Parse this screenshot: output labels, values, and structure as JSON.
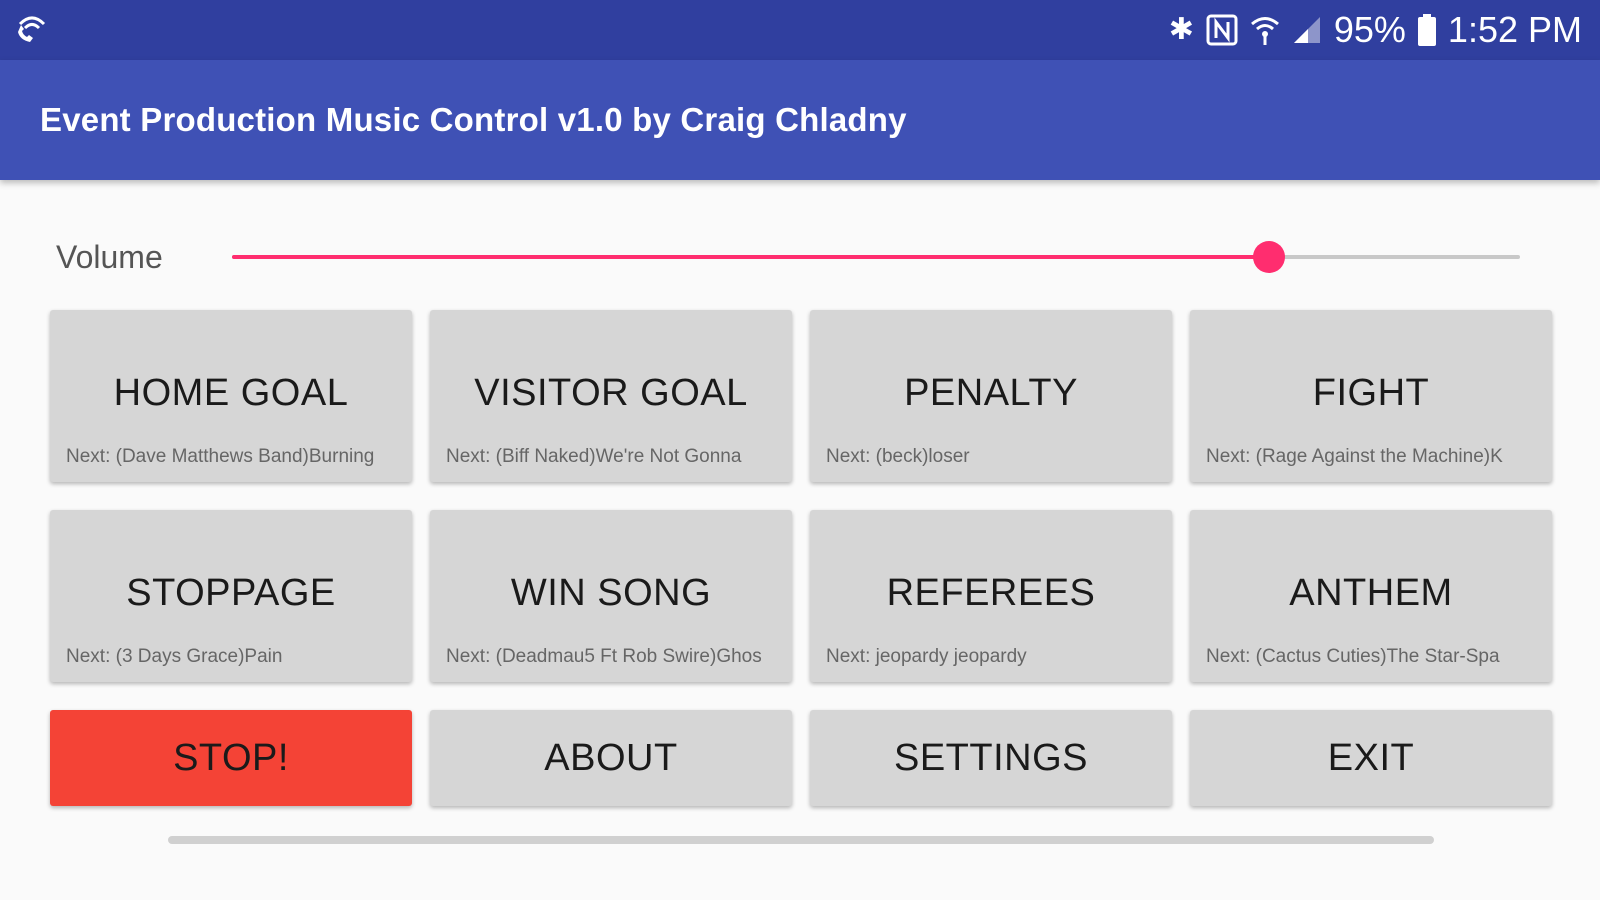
{
  "status_bar": {
    "battery_percent": "95%",
    "time": "1:52 PM",
    "icons": [
      "wifi-call-icon",
      "bluetooth-icon",
      "nfc-icon",
      "wifi-icon",
      "signal-icon",
      "battery-icon"
    ]
  },
  "app_bar": {
    "title": "Event Production Music Control v1.0 by Craig Chladny",
    "color": "#3f51b5"
  },
  "volume": {
    "label": "Volume",
    "level": 0.805,
    "accent": "#ff2d6f"
  },
  "buttons": [
    {
      "title": "HOME GOAL",
      "next": "Next: (Dave Matthews Band)Burning"
    },
    {
      "title": "VISITOR GOAL",
      "next": "Next: (Biff Naked)We're Not Gonna"
    },
    {
      "title": "PENALTY",
      "next": "Next: (beck)loser"
    },
    {
      "title": "FIGHT",
      "next": "Next: (Rage Against the Machine)K"
    },
    {
      "title": "STOPPAGE",
      "next": "Next: (3 Days Grace)Pain"
    },
    {
      "title": "WIN SONG",
      "next": "Next: (Deadmau5 Ft Rob Swire)Ghos"
    },
    {
      "title": "REFEREES",
      "next": "Next: jeopardy jeopardy"
    },
    {
      "title": "ANTHEM",
      "next": "Next: (Cactus Cuties)The Star-Spa"
    }
  ],
  "actions": {
    "stop": "STOP!",
    "about": "ABOUT",
    "settings": "SETTINGS",
    "exit": "EXIT",
    "stop_color": "#f44336"
  }
}
